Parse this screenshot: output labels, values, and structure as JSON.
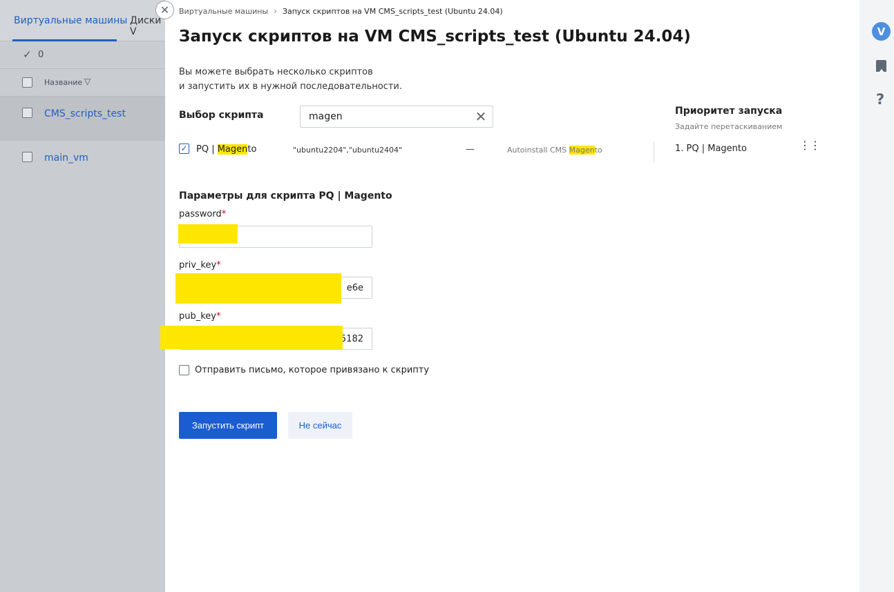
{
  "background": {
    "tabs": [
      "Виртуальные машины",
      "Диски V"
    ],
    "selected_count": "0",
    "column_name": "Название",
    "rows": [
      "CMS_scripts_test",
      "main_vm"
    ]
  },
  "breadcrumb": {
    "root": "Виртуальные машины",
    "current": "Запуск скриптов на VM CMS_scripts_test (Ubuntu 24.04)"
  },
  "title": "Запуск скриптов на VM CMS_scripts_test (Ubuntu 24.04)",
  "description": {
    "line1": "Вы можете выбрать несколько скриптов",
    "line2": "и запустить их в нужной последовательности."
  },
  "script_select": {
    "label": "Выбор скрипта",
    "search_value": "magen"
  },
  "script_row": {
    "checked": true,
    "name_prefix": "PQ | ",
    "name_match": "Magen",
    "name_suffix": "to",
    "os": "\"ubuntu2204\",\"ubuntu2404\"",
    "dash": "—",
    "desc_prefix": "Autoinstall CMS ",
    "desc_match": "Magen",
    "desc_suffix": "to"
  },
  "priority": {
    "title": "Приоритет запуска",
    "subtitle": "Задайте перетаскиванием",
    "items": [
      "1.  PQ | Magento"
    ]
  },
  "params": {
    "title": "Параметры для скрипта PQ | Magento",
    "fields": [
      {
        "label": "password",
        "required_mark": "*",
        "value": ""
      },
      {
        "label": "priv_key",
        "required_mark": "*",
        "value": "e6e"
      },
      {
        "label": "pub_key",
        "required_mark": "*",
        "value": "5182"
      }
    ]
  },
  "send_mail_label": "Отправить письмо, которое привязано к скрипту",
  "buttons": {
    "run": "Запустить скрипт",
    "cancel": "Не сейчас"
  },
  "rail": {
    "avatar_letter": "V"
  },
  "colors": {
    "accent": "#1a5dd1",
    "highlight": "#ffe600",
    "required": "#d0021b"
  }
}
